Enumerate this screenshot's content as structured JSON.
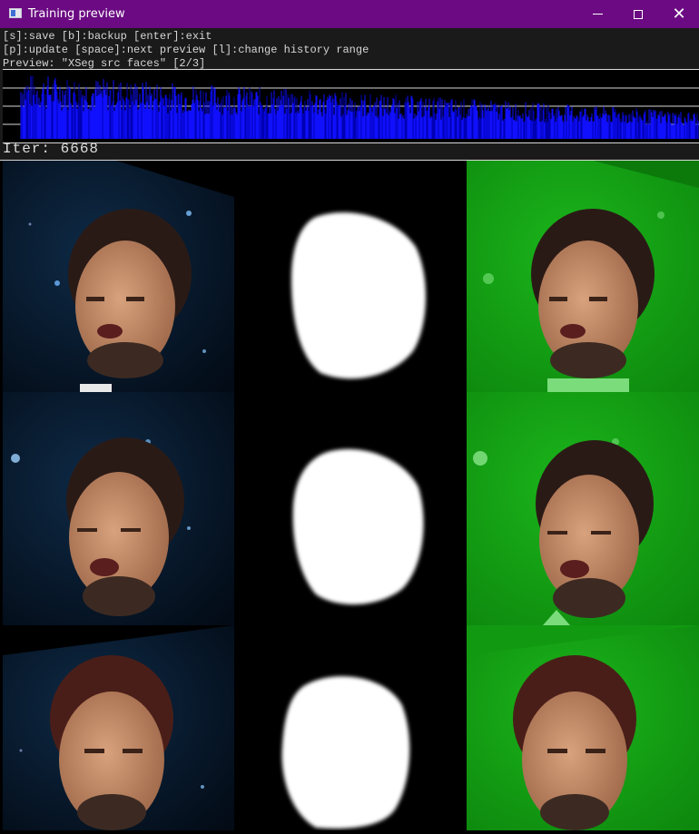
{
  "window": {
    "title": "Training preview",
    "titlebar_color": "#6b0a82",
    "icons": {
      "app": "app-window-icon",
      "minimize": "minimize-icon",
      "maximize": "maximize-icon",
      "close": "close-icon"
    }
  },
  "help": {
    "line1": "[s]:save [b]:backup [enter]:exit",
    "line2": "[p]:update [space]:next preview [l]:change history range",
    "line3": "Preview: \"XSeg src faces\" [2/3]"
  },
  "loss_graph": {
    "colors": {
      "series": "#1010ff",
      "series_dark": "#0000b4",
      "grid": "#d8d8d8"
    }
  },
  "iteration": {
    "label": "Iter: 6668",
    "value": 6668
  },
  "preview": {
    "columns": [
      "source face",
      "predicted mask",
      "masked overlay"
    ],
    "rows": 3,
    "colors": {
      "overlay_green": "#119a11",
      "mask": "#ffffff",
      "background": "#000000"
    }
  }
}
